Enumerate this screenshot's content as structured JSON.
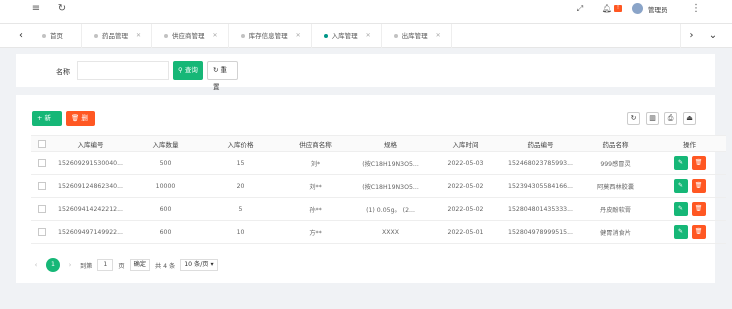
{
  "topbar": {
    "menu_icon": "menu-icon",
    "refresh_icon": "refresh-icon",
    "bell_badge": "!",
    "username": "管理员",
    "more_icon": "more-icon"
  },
  "tabs": [
    {
      "label": "首页",
      "active": false
    },
    {
      "label": "药品管理",
      "active": false
    },
    {
      "label": "供应商管理",
      "active": false
    },
    {
      "label": "库存信息管理",
      "active": false
    },
    {
      "label": "入库管理",
      "active": true
    },
    {
      "label": "出库管理",
      "active": false
    }
  ],
  "search": {
    "label": "名称",
    "input_value": "",
    "search_button": "查询",
    "reset_button": "重置"
  },
  "toolbar": {
    "add_button": "+ 新增",
    "delete_button": "删除"
  },
  "table": {
    "columns": [
      "入库编号",
      "入库数量",
      "入库价格",
      "供应商名称",
      "规格",
      "入库时间",
      "药品编号",
      "药品名称",
      "操作"
    ],
    "rows": [
      [
        "152609291530040...",
        "500",
        "15",
        "刘*",
        "(按C18H19N3O5...",
        "2022-05-03",
        "152468023785993...",
        "999感冒灵"
      ],
      [
        "152609124862340...",
        "10000",
        "20",
        "刘**",
        "(按C18H19N3O5...",
        "2022-05-02",
        "152394305584166...",
        "阿莫西林胶囊"
      ],
      [
        "152609414242212...",
        "600",
        "5",
        "孙**",
        "(1) 0.05g。 (2...",
        "2022-05-02",
        "152804801435333...",
        "丹皮酚软膏"
      ],
      [
        "152609497149922...",
        "600",
        "10",
        "方**",
        "XXXX",
        "2022-05-01",
        "152804978999515...",
        "健胃消食片"
      ]
    ]
  },
  "pager": {
    "current_page": "1",
    "goto_label": "到第",
    "goto_value": "1",
    "page_unit": "页",
    "confirm": "确定",
    "total": "共 4 条",
    "per_page": "10 条/页"
  }
}
